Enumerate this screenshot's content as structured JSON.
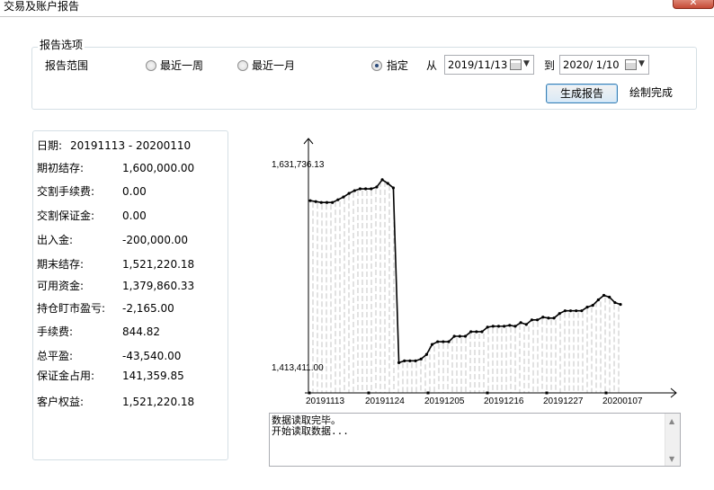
{
  "window": {
    "title": "交易及账户报告",
    "close_glyph": "✕"
  },
  "options": {
    "group_title": "报告选项",
    "range_label": "报告范围",
    "radios": [
      {
        "label": "最近一周",
        "checked": false
      },
      {
        "label": "最近一月",
        "checked": false
      },
      {
        "label": "指定",
        "checked": true
      }
    ],
    "from_label": "从",
    "from_date": "2019/11/13",
    "to_label": "到",
    "to_date": "2020/ 1/10",
    "generate_button": "生成报告",
    "status": "绘制完成"
  },
  "summary": [
    {
      "label": "日期:",
      "value": "20191113 - 20200110"
    },
    {
      "label": "期初结存:",
      "value": "1,600,000.00"
    },
    {
      "label": "交割手续费:",
      "value": "0.00"
    },
    {
      "label": "交割保证金:",
      "value": "0.00"
    },
    {
      "label": "出入金:",
      "value": "-200,000.00"
    },
    {
      "label": "期末结存:",
      "value": "1,521,220.18"
    },
    {
      "label": "可用资金:",
      "value": "1,379,860.33"
    },
    {
      "label": "持仓盯市盈亏:",
      "value": "-2,165.00"
    },
    {
      "label": "手续费:",
      "value": "844.82"
    },
    {
      "label": "总平盈:",
      "value": "-43,540.00"
    },
    {
      "label": "保证金占用:",
      "value": "141,359.85"
    },
    {
      "label": "客户权益:",
      "value": "1,521,220.18"
    }
  ],
  "chart_data": {
    "type": "line",
    "y_max_label": "1,631,736.13",
    "y_min_label": "1,413,411.00",
    "ylim": [
      1413411.0,
      1631736.13
    ],
    "x_ticks": [
      "20191113",
      "20191124",
      "20191205",
      "20191216",
      "20191227",
      "20200107"
    ],
    "values": [
      1595000,
      1594000,
      1593000,
      1593000,
      1593000,
      1596000,
      1599000,
      1603000,
      1606000,
      1608000,
      1608000,
      1608000,
      1610000,
      1618000,
      1614000,
      1609000,
      1417000,
      1419000,
      1419000,
      1419000,
      1421000,
      1426000,
      1437000,
      1440000,
      1440000,
      1440000,
      1446000,
      1446000,
      1446000,
      1451000,
      1451000,
      1451000,
      1456000,
      1457000,
      1457000,
      1457000,
      1458000,
      1457000,
      1461000,
      1459000,
      1464000,
      1464000,
      1467000,
      1466000,
      1466000,
      1471000,
      1474000,
      1474000,
      1474000,
      1474000,
      1478000,
      1480000,
      1486000,
      1491000,
      1489000,
      1483000,
      1481000
    ]
  },
  "log": {
    "lines": [
      "数据读取完毕。",
      "开始读取数据..."
    ]
  }
}
